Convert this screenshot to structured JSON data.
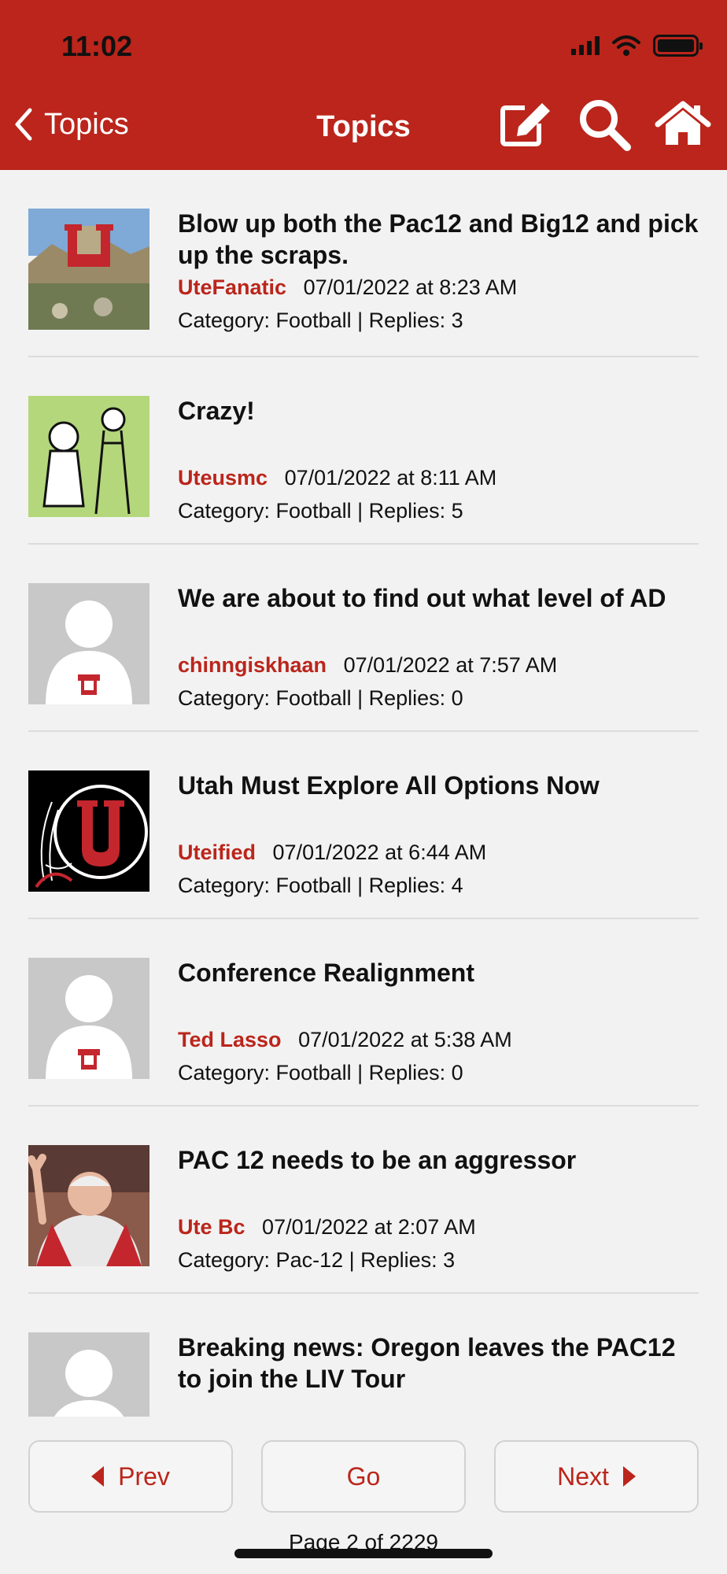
{
  "status_bar": {
    "time": "11:02"
  },
  "nav": {
    "back_label": "Topics",
    "title": "Topics",
    "actions": [
      "compose-icon",
      "search-icon",
      "home-icon"
    ]
  },
  "topics": [
    {
      "title": "Blow up both the Pac12 and Big12 and pick up the scraps.",
      "author": "UteFanatic",
      "date": "07/01/2022 at 8:23 AM",
      "info": "Category: Football | Replies: 3",
      "avatar": "campus-photo"
    },
    {
      "title": "Crazy!",
      "author": "Uteusmc",
      "date": "07/01/2022 at 8:11 AM",
      "info": "Category: Football | Replies: 5",
      "avatar": "cartoon-couple"
    },
    {
      "title": "We are about to find out what level of AD",
      "author": "chinngiskhaan",
      "date": "07/01/2022 at 7:57 AM",
      "info": "Category: Football | Replies: 0",
      "avatar": "default-user"
    },
    {
      "title": "Utah Must Explore All Options Now",
      "author": "Uteified",
      "date": "07/01/2022 at 6:44 AM",
      "info": "Category: Football | Replies: 4",
      "avatar": "u-logo-black"
    },
    {
      "title": "Conference Realignment",
      "author": "Ted Lasso",
      "date": "07/01/2022 at 5:38 AM",
      "info": "Category: Football | Replies: 0",
      "avatar": "default-user"
    },
    {
      "title": "PAC 12 needs to be an aggressor",
      "author": "Ute Bc",
      "date": "07/01/2022 at 2:07 AM",
      "info": "Category: Pac-12 | Replies: 3",
      "avatar": "coach-photo"
    },
    {
      "title": "Breaking news: Oregon leaves the PAC12 to join the LIV Tour",
      "author": "",
      "date": "",
      "info": "",
      "avatar": "default-user"
    }
  ],
  "pager": {
    "prev_label": "Prev",
    "go_label": "Go",
    "next_label": "Next",
    "page_info": "Page 2 of 2229"
  },
  "colors": {
    "accent": "#bb251b",
    "background": "#f2f2f2"
  }
}
